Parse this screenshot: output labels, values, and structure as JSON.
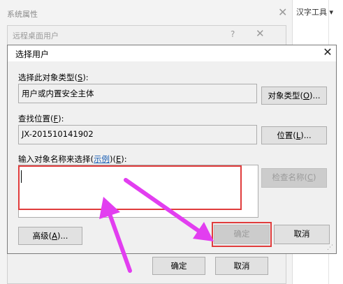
{
  "background_window": {
    "title": "系统属性",
    "menu_item": "汉字工具 ▾"
  },
  "remote_users_window": {
    "title": "远程桌面用户",
    "help_glyph": "?",
    "ok_label": "确定",
    "cancel_label": "取消"
  },
  "dialog": {
    "title": "选择用户",
    "object_type": {
      "label_prefix": "选择此对象类型(",
      "label_key": "S",
      "label_suffix": "):",
      "value": "用户或内置安全主体",
      "button_prefix": "对象类型(",
      "button_key": "O",
      "button_suffix": ")..."
    },
    "location": {
      "label_prefix": "查找位置(",
      "label_key": "F",
      "label_suffix": "):",
      "value": "JX-201510141902",
      "button_prefix": "位置(",
      "button_key": "L",
      "button_suffix": ")..."
    },
    "names": {
      "label_prefix": "输入对象名称来选择(",
      "examples_link": "示例",
      "label_mid": ")(",
      "label_key": "E",
      "label_suffix": "):",
      "value": "",
      "check_button_prefix": "检查名称(",
      "check_button_key": "C",
      "check_button_suffix": ")"
    },
    "advanced_button": {
      "prefix": "高级(",
      "key": "A",
      "suffix": ")..."
    },
    "ok_button": "确定",
    "cancel_button": "取消"
  },
  "icons": [
    "close-icon",
    "help-icon",
    "resize-grip-icon"
  ],
  "colors": {
    "highlight_box": "#e03c3c",
    "arrow": "#e23ef0",
    "link": "#1a5fb4"
  }
}
